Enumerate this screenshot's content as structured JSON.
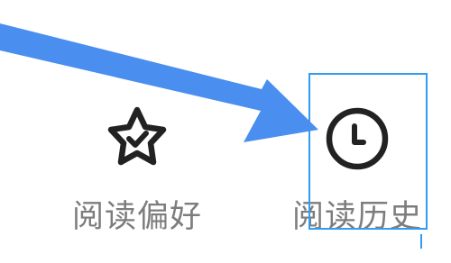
{
  "menu": {
    "items": [
      {
        "label": "阅读偏好",
        "icon": "star-check-icon"
      },
      {
        "label": "阅读历史",
        "icon": "clock-icon"
      }
    ]
  },
  "annotation": {
    "arrow_color": "#4a8ef0",
    "box_color": "#2f9cf5",
    "highlighted_item": "阅读历史"
  }
}
